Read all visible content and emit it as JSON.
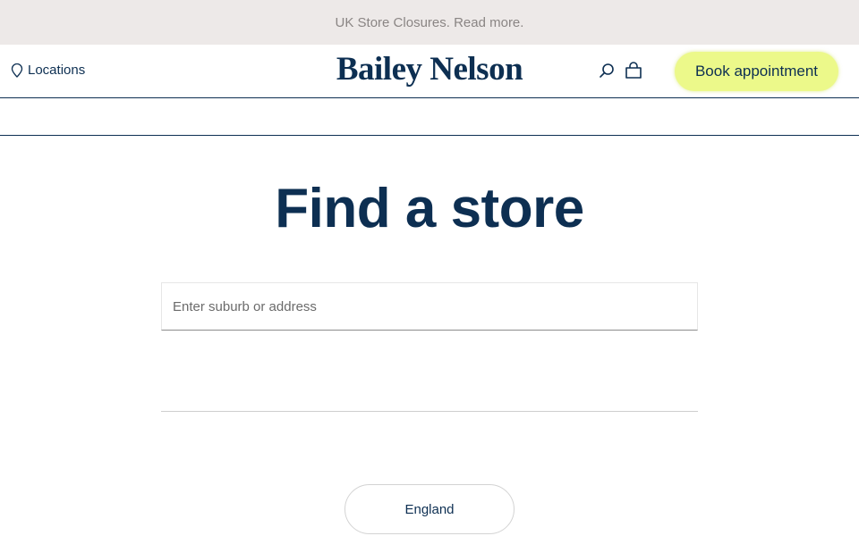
{
  "announcement": {
    "text": "UK Store Closures. Read more."
  },
  "header": {
    "locations_label": "Locations",
    "logo_text": "Bailey Nelson",
    "search_icon": "search-icon",
    "bag_icon": "bag-icon",
    "book_button_label": "Book appointment"
  },
  "main": {
    "title": "Find a store",
    "search": {
      "placeholder": "Enter suburb or address",
      "value": ""
    },
    "regions": [
      {
        "label": "England"
      }
    ]
  },
  "colors": {
    "brand_navy": "#0d2f52",
    "accent_yellow": "#ecf98a",
    "announcement_bg": "#ede9e8"
  }
}
